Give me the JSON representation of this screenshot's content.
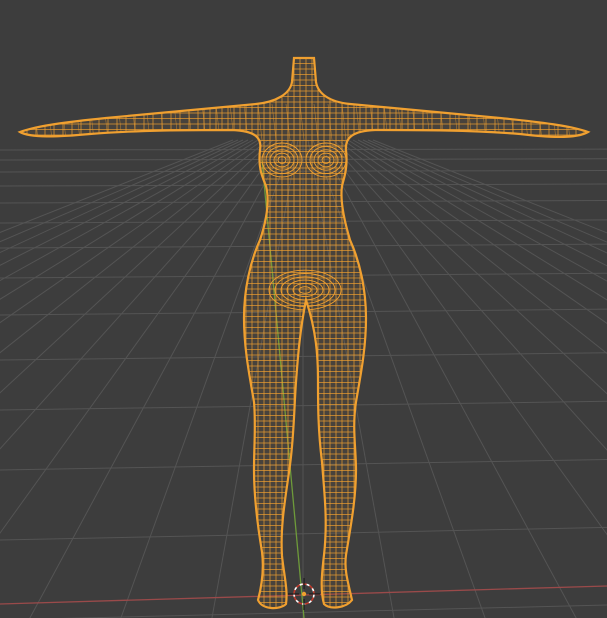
{
  "viewport": {
    "background": "#3d3d3d",
    "grid_color": "#545454",
    "x_axis_color": "#9a4a4a",
    "y_axis_color": "#6e9a3a",
    "wireframe_color": "#f0a030",
    "cursor_primary": "#ffffff",
    "cursor_secondary": "#c0392b",
    "selected_object": "body-mesh",
    "mode": "wireframe"
  }
}
